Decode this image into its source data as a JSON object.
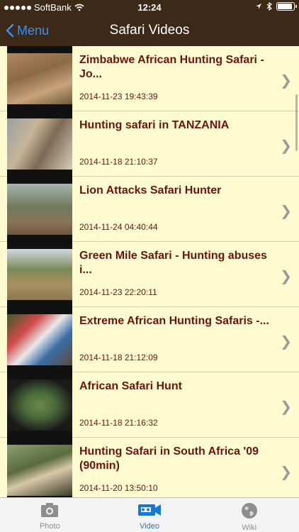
{
  "status": {
    "carrier": "SoftBank",
    "time": "12:24"
  },
  "nav": {
    "back_label": "Menu",
    "title": "Safari Videos"
  },
  "videos": [
    {
      "title": "Zimbabwe African Hunting Safari - Jo...",
      "date": "2014-11-23 19:43:39"
    },
    {
      "title": "Hunting safari in TANZANIA",
      "date": "2014-11-18 21:10:37"
    },
    {
      "title": "Lion Attacks Safari Hunter",
      "date": "2014-11-24 04:40:44"
    },
    {
      "title": "Green Mile Safari - Hunting abuses i...",
      "date": "2014-11-23 22:20:11"
    },
    {
      "title": "Extreme African Hunting Safaris -...",
      "date": "2014-11-18 21:12:09"
    },
    {
      "title": "African Safari Hunt",
      "date": "2014-11-18 21:16:32"
    },
    {
      "title": "Hunting Safari in South Africa '09 (90min)",
      "date": "2014-11-20 13:50:10"
    }
  ],
  "tabs": [
    {
      "label": "Photo",
      "icon": "camera-icon"
    },
    {
      "label": "Video",
      "icon": "video-camera-icon"
    },
    {
      "label": "Wiki",
      "icon": "globe-icon"
    }
  ],
  "colors": {
    "bar": "#3d2917",
    "list_bg": "#fffbd0",
    "title": "#6b1414",
    "accent": "#1a78d0"
  }
}
